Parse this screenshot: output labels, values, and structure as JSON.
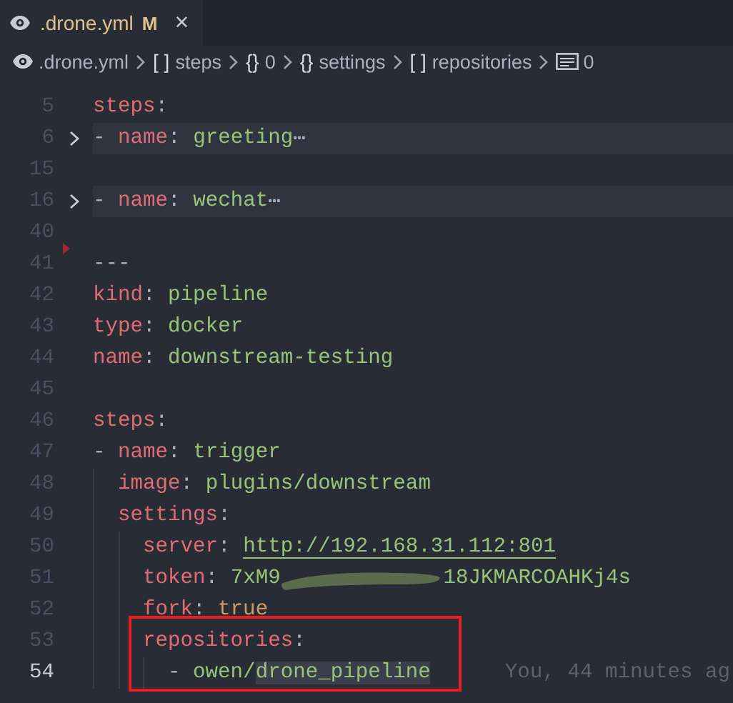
{
  "tabs": [
    {
      "title": ".drone.yml",
      "badge": "M",
      "close": "×",
      "selected": true
    }
  ],
  "breadcrumbs": [
    {
      "kind": "file",
      "label": ".drone.yml"
    },
    {
      "kind": "array",
      "symbol": "[ ]",
      "label": "steps"
    },
    {
      "kind": "object",
      "symbol": "{}",
      "label": "0"
    },
    {
      "kind": "object",
      "symbol": "{}",
      "label": "settings"
    },
    {
      "kind": "array",
      "symbol": "[ ]",
      "label": "repositories"
    },
    {
      "kind": "string",
      "label": "0"
    }
  ],
  "lines": [
    {
      "number": "5",
      "folded": false,
      "current": false,
      "boxed": false,
      "deleted_marker": false,
      "tokens": [
        {
          "kind": "key",
          "text": "steps"
        },
        {
          "kind": "punct",
          "text": ":"
        }
      ]
    },
    {
      "number": "6",
      "folded": true,
      "current": false,
      "boxed": false,
      "deleted_marker": false,
      "tokens": [
        {
          "kind": "punct",
          "text": "-"
        },
        {
          "kind": "key",
          "text": "name"
        },
        {
          "kind": "punct",
          "text": ":"
        },
        {
          "kind": "value",
          "text": "greeting"
        },
        {
          "kind": "ellipsis",
          "text": "⋯"
        }
      ]
    },
    {
      "number": "15",
      "folded": false,
      "current": false,
      "boxed": false,
      "deleted_marker": false
    },
    {
      "number": "16",
      "folded": true,
      "current": false,
      "boxed": false,
      "deleted_marker": false,
      "tokens": [
        {
          "kind": "punct",
          "text": "-"
        },
        {
          "kind": "key",
          "text": "name"
        },
        {
          "kind": "punct",
          "text": ":"
        },
        {
          "kind": "value",
          "text": "wechat"
        },
        {
          "kind": "ellipsis",
          "text": "⋯"
        }
      ]
    },
    {
      "number": "40",
      "folded": false,
      "current": false,
      "boxed": false,
      "deleted_marker": false
    },
    {
      "number": "41",
      "folded": false,
      "current": false,
      "boxed": false,
      "deleted_marker": true,
      "tokens": [
        {
          "kind": "punct",
          "text": "---"
        }
      ]
    },
    {
      "number": "42",
      "folded": false,
      "current": false,
      "boxed": false,
      "deleted_marker": false,
      "tokens": [
        {
          "kind": "key",
          "text": "kind"
        },
        {
          "kind": "punct",
          "text": ":"
        },
        {
          "kind": "value",
          "text": "pipeline"
        }
      ]
    },
    {
      "number": "43",
      "folded": false,
      "current": false,
      "boxed": false,
      "deleted_marker": false,
      "tokens": [
        {
          "kind": "key",
          "text": "type"
        },
        {
          "kind": "punct",
          "text": ":"
        },
        {
          "kind": "value",
          "text": "docker"
        }
      ]
    },
    {
      "number": "44",
      "folded": false,
      "current": false,
      "boxed": false,
      "deleted_marker": false,
      "tokens": [
        {
          "kind": "key",
          "text": "name"
        },
        {
          "kind": "punct",
          "text": ":"
        },
        {
          "kind": "value",
          "text": "downstream-testing"
        }
      ]
    },
    {
      "number": "45",
      "folded": false,
      "current": false,
      "boxed": false,
      "deleted_marker": false
    },
    {
      "number": "46",
      "folded": false,
      "current": false,
      "boxed": false,
      "deleted_marker": false,
      "tokens": [
        {
          "kind": "key",
          "text": "steps"
        },
        {
          "kind": "punct",
          "text": ":"
        }
      ]
    },
    {
      "number": "47",
      "folded": false,
      "current": false,
      "boxed": false,
      "deleted_marker": false,
      "tokens": [
        {
          "kind": "punct",
          "text": "-"
        },
        {
          "kind": "key",
          "text": "name"
        },
        {
          "kind": "punct",
          "text": ":"
        },
        {
          "kind": "value",
          "text": "trigger"
        }
      ]
    },
    {
      "number": "48",
      "folded": false,
      "current": false,
      "boxed": false,
      "deleted_marker": false,
      "tokens": [
        {
          "kind": "guide"
        },
        {
          "kind": "key",
          "text": "image"
        },
        {
          "kind": "punct",
          "text": ":"
        },
        {
          "kind": "value",
          "text": "plugins/downstream"
        }
      ]
    },
    {
      "number": "49",
      "folded": false,
      "current": false,
      "boxed": false,
      "deleted_marker": false,
      "tokens": [
        {
          "kind": "guide"
        },
        {
          "kind": "key",
          "text": "settings"
        },
        {
          "kind": "punct",
          "text": ":"
        }
      ]
    },
    {
      "number": "50",
      "folded": false,
      "current": false,
      "boxed": false,
      "deleted_marker": false,
      "tokens": [
        {
          "kind": "guide"
        },
        {
          "kind": "guide"
        },
        {
          "kind": "key",
          "text": "server"
        },
        {
          "kind": "punct",
          "text": ":"
        },
        {
          "kind": "link",
          "text": "http://192.168.31.112:801"
        }
      ]
    },
    {
      "number": "51",
      "folded": false,
      "current": false,
      "boxed": false,
      "deleted_marker": false,
      "tokens": [
        {
          "kind": "guide"
        },
        {
          "kind": "guide"
        },
        {
          "kind": "key",
          "text": "token"
        },
        {
          "kind": "punct",
          "text": ":"
        },
        {
          "kind": "value",
          "text": "7xM9"
        },
        {
          "kind": "scribble"
        },
        {
          "kind": "value",
          "text": "18JKMARCOAHKj4s"
        }
      ]
    },
    {
      "number": "52",
      "folded": false,
      "current": false,
      "boxed": false,
      "deleted_marker": false,
      "tokens": [
        {
          "kind": "guide"
        },
        {
          "kind": "guide"
        },
        {
          "kind": "key",
          "text": "fork"
        },
        {
          "kind": "punct",
          "text": ":"
        },
        {
          "kind": "bool",
          "text": "true"
        }
      ]
    },
    {
      "number": "53",
      "folded": false,
      "current": false,
      "boxed": true,
      "deleted_marker": false,
      "tokens": [
        {
          "kind": "guide"
        },
        {
          "kind": "guide"
        },
        {
          "kind": "key",
          "text": "repositories"
        },
        {
          "kind": "punct",
          "text": ":"
        }
      ]
    },
    {
      "number": "54",
      "folded": false,
      "current": true,
      "boxed": true,
      "deleted_marker": false,
      "tokens": [
        {
          "kind": "guide"
        },
        {
          "kind": "guide"
        },
        {
          "kind": "guide"
        },
        {
          "kind": "punct",
          "text": "-"
        },
        {
          "kind": "value",
          "text": "owen/"
        },
        {
          "kind": "selected",
          "text": "drone_pipeline"
        },
        {
          "kind": "blame",
          "text": "You, 44 minutes ag"
        }
      ]
    }
  ]
}
